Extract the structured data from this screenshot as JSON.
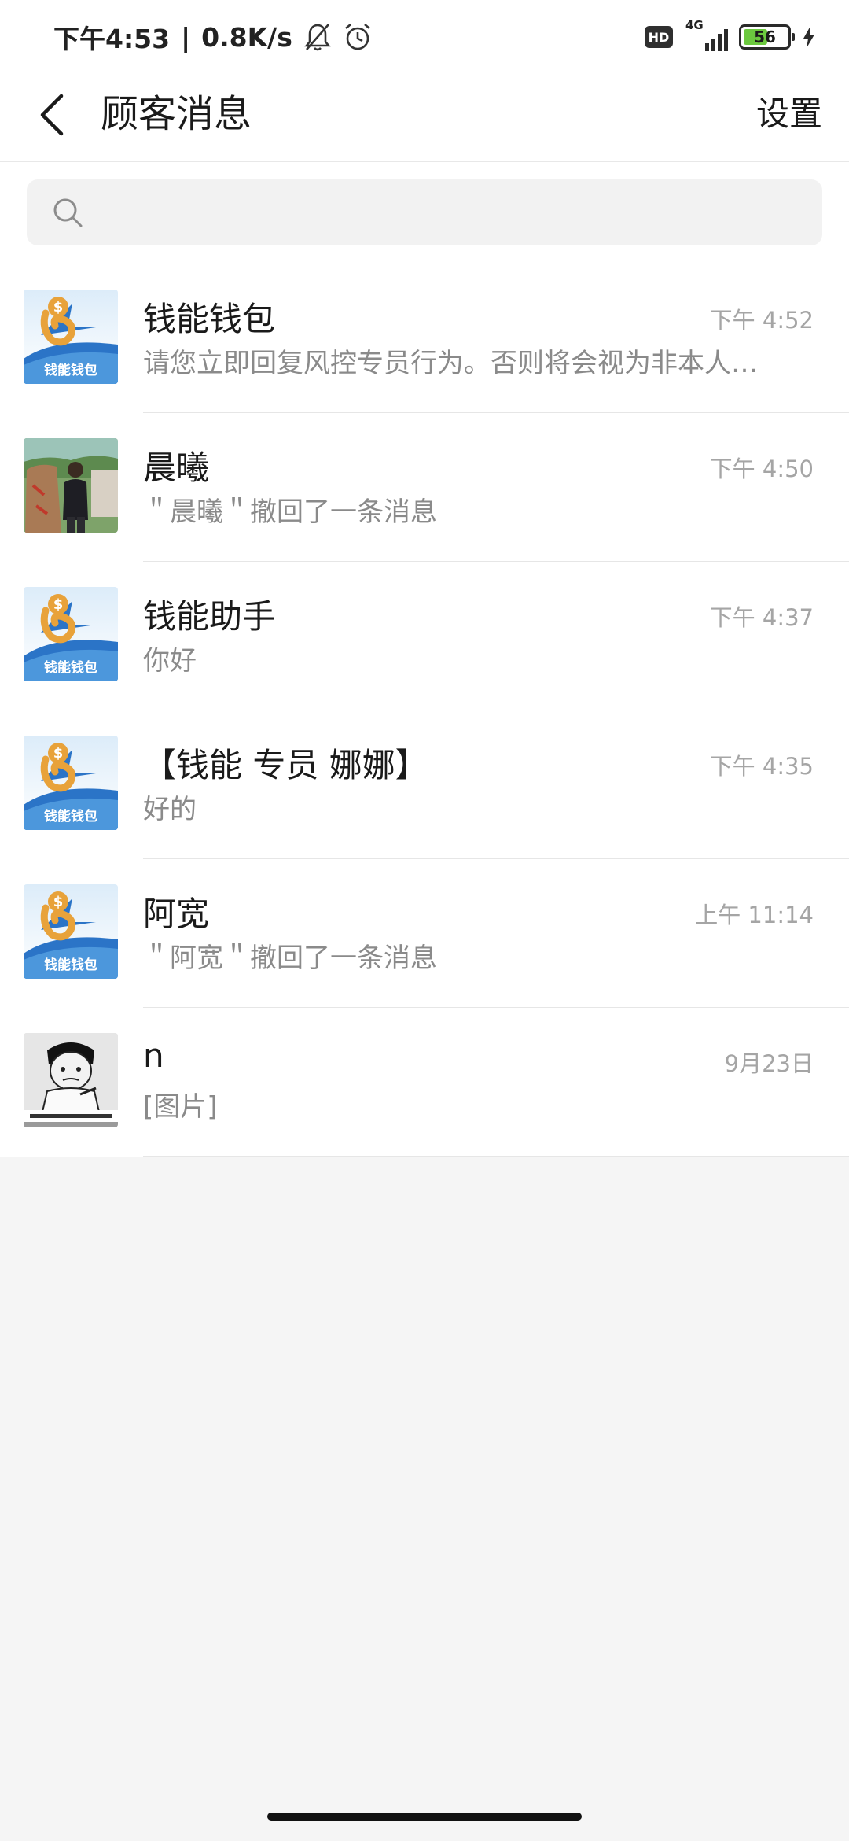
{
  "status_bar": {
    "time": "下午4:53",
    "separator": "|",
    "net_speed": "0.8K/s",
    "hd_label": "HD",
    "network_type": "4G",
    "battery_level": "56",
    "battery_fill_fraction": 0.56,
    "battery_color": "#6cc93f"
  },
  "header": {
    "title": "顾客消息",
    "settings_label": "设置"
  },
  "search": {
    "placeholder": ""
  },
  "messages": [
    {
      "name": "钱能钱包",
      "preview": "请您立即回复风控专员行为。否则将会视为非本人…",
      "time": "下午 4:52",
      "avatar": "qianneng-logo"
    },
    {
      "name": "晨曦",
      "preview": "＂晨曦＂撤回了一条消息",
      "time": "下午 4:50",
      "avatar": "photo-portrait"
    },
    {
      "name": "钱能助手",
      "preview": "你好",
      "time": "下午 4:37",
      "avatar": "qianneng-logo"
    },
    {
      "name": "【钱能 专员 娜娜】",
      "preview": "好的",
      "time": "下午 4:35",
      "avatar": "qianneng-logo"
    },
    {
      "name": "阿宽",
      "preview": "＂阿宽＂撤回了一条消息",
      "time": "上午 11:14",
      "avatar": "qianneng-logo"
    },
    {
      "name": "n",
      "preview": "[图片]",
      "time": "9月23日",
      "avatar": "meme-cartoon"
    }
  ],
  "logo_text": "钱能钱包",
  "colors": {
    "page_bg": "#f5f5f5",
    "header_bg": "#ffffff",
    "time_gray": "#a5a5a5",
    "preview_gray": "#8a8a8a",
    "logo_gold": "#e8a23a",
    "logo_blue": "#2b74c7"
  }
}
